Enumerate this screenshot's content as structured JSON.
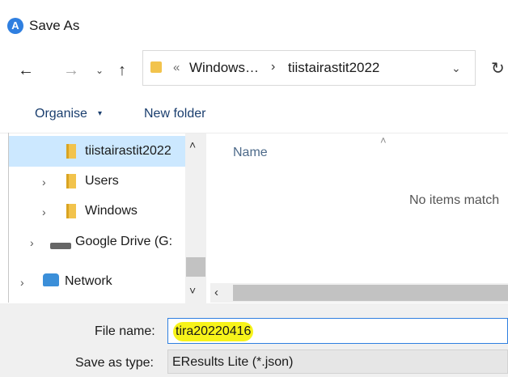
{
  "window": {
    "title": "Save As",
    "app_icon": "A"
  },
  "nav": {
    "back_icon": "←",
    "forward_icon": "→",
    "recent_icon": "⌄",
    "up_icon": "↑",
    "refresh_icon": "↻"
  },
  "address": {
    "overflow": "«",
    "segments": [
      "Windows…",
      "tiistairastit2022"
    ],
    "separator": "›",
    "dropdown": "⌄"
  },
  "toolbar": {
    "organise_label": "Organise",
    "organise_caret": "▾",
    "new_folder_label": "New folder"
  },
  "tree": {
    "items": [
      {
        "label": "tiistairastit2022",
        "selected": true
      },
      {
        "label": "Users",
        "chevron": "›"
      },
      {
        "label": "Windows",
        "chevron": "›"
      },
      {
        "label": "Google Drive (G:",
        "chevron": "›"
      },
      {
        "label": "Network",
        "chevron": "›"
      }
    ],
    "scroll_up": "˄",
    "scroll_down": "˅"
  },
  "files": {
    "column_name": "Name",
    "sort_indicator": "˄",
    "empty_message": "No items match",
    "scroll_left": "‹"
  },
  "form": {
    "file_name_label": "File name:",
    "file_name_value": "tira20220416",
    "save_type_label": "Save as type:",
    "save_type_value": "EResults Lite (*.json)"
  },
  "colors": {
    "accent": "#2f7fe0",
    "selection": "#cce8ff",
    "highlight": "#f7f31a",
    "folder": "#f2c34c"
  }
}
